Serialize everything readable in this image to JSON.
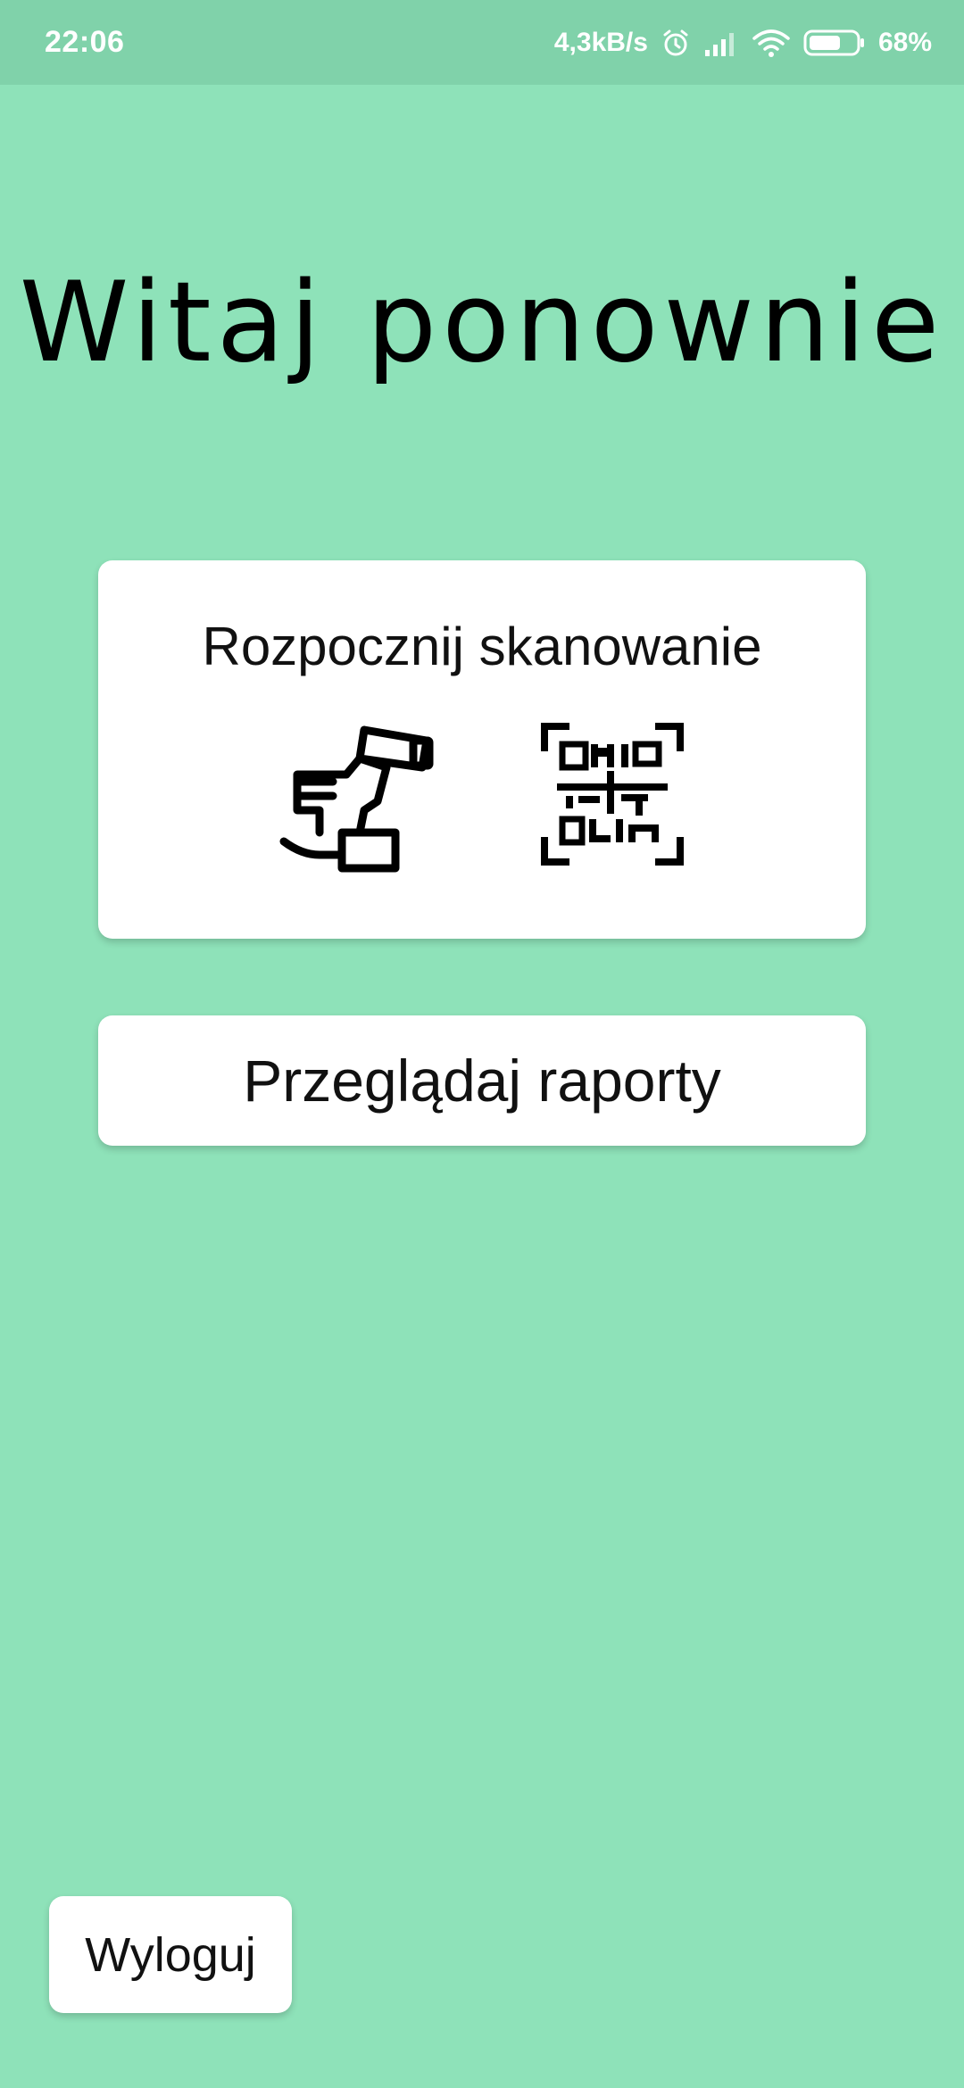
{
  "status_bar": {
    "time": "22:06",
    "network_speed": "4,3kB/s",
    "battery": "68%",
    "battery_level": 0.68,
    "icons": [
      "alarm-icon",
      "signal-icon",
      "wifi-icon",
      "battery-icon"
    ]
  },
  "title": "Witaj ponownie",
  "scan_card": {
    "label": "Rozpocznij skanowanie",
    "icons": [
      "hand-scanner-icon",
      "qr-code-icon"
    ]
  },
  "reports_button": {
    "label": "Przeglądaj raporty"
  },
  "logout_button": {
    "label": "Wyloguj"
  },
  "colors": {
    "background": "#8ee2b9",
    "status_bar": "#80d2aa",
    "card": "#ffffff"
  }
}
